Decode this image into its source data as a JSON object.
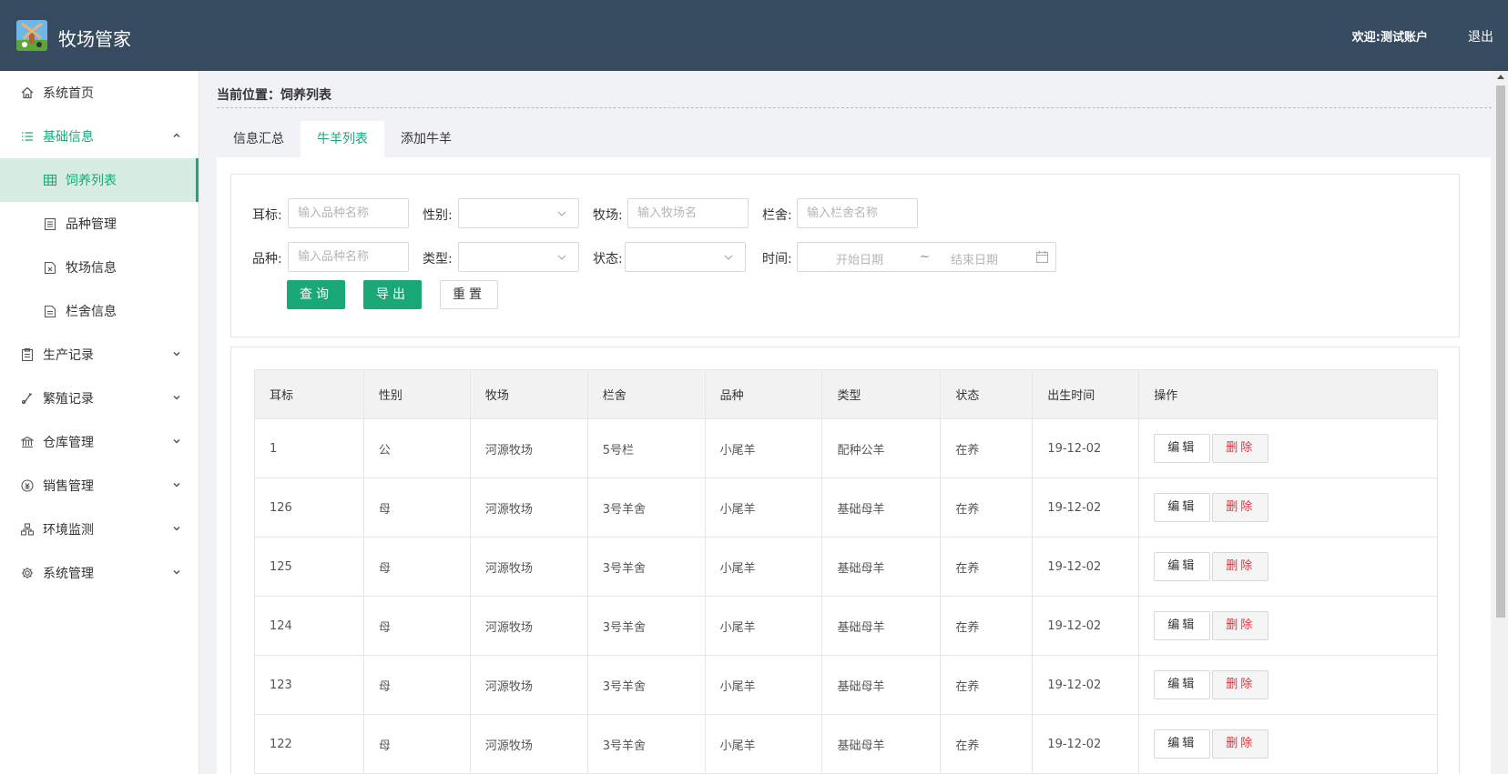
{
  "app": {
    "title": "牧场管家",
    "welcome": "欢迎:测试账户",
    "logout": "退出"
  },
  "colors": {
    "header_bg": "#364b60",
    "accent": "#1aa877",
    "danger": "#e0303b"
  },
  "sidebar": {
    "items": [
      {
        "label": "系统首页",
        "icon": "home-icon"
      },
      {
        "label": "基础信息",
        "icon": "list-icon",
        "expanded": true,
        "children": [
          {
            "label": "饲养列表",
            "icon": "table-icon",
            "active": true
          },
          {
            "label": "品种管理",
            "icon": "document-icon"
          },
          {
            "label": "牧场信息",
            "icon": "file-x-icon"
          },
          {
            "label": "栏舍信息",
            "icon": "file-text-icon"
          }
        ]
      },
      {
        "label": "生产记录",
        "icon": "clipboard-icon"
      },
      {
        "label": "繁殖记录",
        "icon": "dna-icon"
      },
      {
        "label": "仓库管理",
        "icon": "bank-icon"
      },
      {
        "label": "销售管理",
        "icon": "coin-icon"
      },
      {
        "label": "环境监测",
        "icon": "network-icon"
      },
      {
        "label": "系统管理",
        "icon": "gear-icon"
      }
    ]
  },
  "breadcrumb": "当前位置：饲养列表",
  "tabs": [
    "信息汇总",
    "牛羊列表",
    "添加牛羊"
  ],
  "active_tab": "牛羊列表",
  "filters": {
    "ear_tag": {
      "label": "耳标:",
      "placeholder": "输入品种名称"
    },
    "gender": {
      "label": "性别:"
    },
    "farm": {
      "label": "牧场:",
      "placeholder": "输入牧场名"
    },
    "pen": {
      "label": "栏舍:",
      "placeholder": "输入栏舍名称"
    },
    "breed": {
      "label": "品种:",
      "placeholder": "输入品种名称"
    },
    "type": {
      "label": "类型:"
    },
    "status": {
      "label": "状态:"
    },
    "time": {
      "label": "时间:",
      "start_placeholder": "开始日期",
      "separator": "~",
      "end_placeholder": "结束日期"
    },
    "query_button": "查询",
    "export_button": "导出",
    "reset_button": "重置"
  },
  "table": {
    "columns": [
      "耳标",
      "性别",
      "牧场",
      "栏舍",
      "品种",
      "类型",
      "状态",
      "出生时间",
      "操作"
    ],
    "edit_label": "编辑",
    "delete_label": "删除",
    "rows": [
      [
        "1",
        "公",
        "河源牧场",
        "5号栏",
        "小尾羊",
        "配种公羊",
        "在养",
        "19-12-02"
      ],
      [
        "126",
        "母",
        "河源牧场",
        "3号羊舍",
        "小尾羊",
        "基础母羊",
        "在养",
        "19-12-02"
      ],
      [
        "125",
        "母",
        "河源牧场",
        "3号羊舍",
        "小尾羊",
        "基础母羊",
        "在养",
        "19-12-02"
      ],
      [
        "124",
        "母",
        "河源牧场",
        "3号羊舍",
        "小尾羊",
        "基础母羊",
        "在养",
        "19-12-02"
      ],
      [
        "123",
        "母",
        "河源牧场",
        "3号羊舍",
        "小尾羊",
        "基础母羊",
        "在养",
        "19-12-02"
      ],
      [
        "122",
        "母",
        "河源牧场",
        "3号羊舍",
        "小尾羊",
        "基础母羊",
        "在养",
        "19-12-02"
      ]
    ]
  }
}
